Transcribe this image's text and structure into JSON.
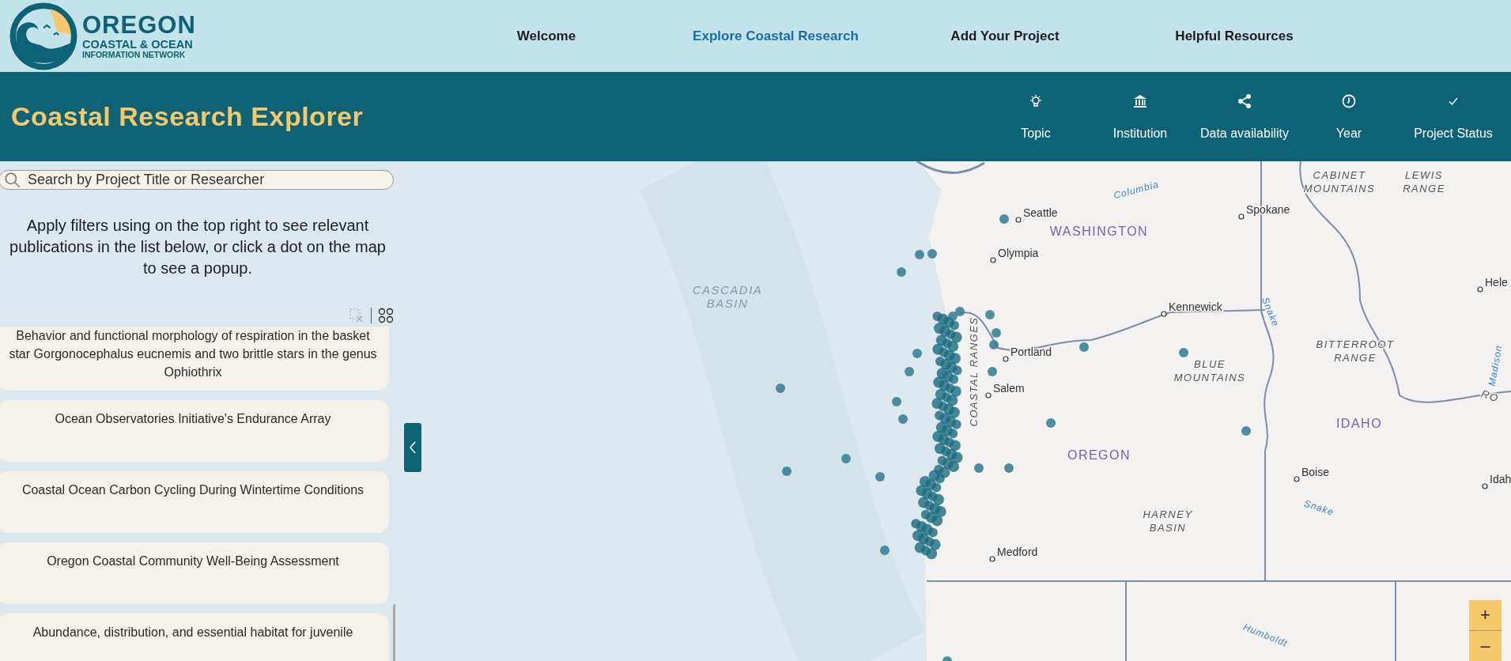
{
  "logo": {
    "title": "OREGON",
    "line_1": "COASTAL & OCEAN",
    "line_2": "INFORMATION NETWORK"
  },
  "nav": [
    {
      "label": "Welcome",
      "selected": false
    },
    {
      "label": "Explore Coastal Research",
      "selected": true
    },
    {
      "label": "Add Your Project",
      "selected": false
    },
    {
      "label": "Helpful Resources",
      "selected": false
    }
  ],
  "app_title": "Coastal Research Explorer",
  "filters": [
    {
      "label": "Topic",
      "kind": "bulb"
    },
    {
      "label": "Institution",
      "kind": "institution"
    },
    {
      "label": "Data availability",
      "kind": "share"
    },
    {
      "label": "Year",
      "kind": "clock"
    },
    {
      "label": "Project Status",
      "kind": "check"
    }
  ],
  "search": {
    "placeholder": "Search by Project Title or Researcher"
  },
  "instructions": "Apply filters using on the top right to see relevant publications in the list below, or click a dot on the map to see a popup.",
  "projects": [
    {
      "title": "Behavior and functional morphology of respiration in the basket star Gorgonocephalus eucnemis and two brittle stars in the genus Ophiothrix"
    },
    {
      "title": "Ocean Observatories Initiative's Endurance Array"
    },
    {
      "title": "Coastal Ocean Carbon Cycling During Wintertime Conditions"
    },
    {
      "title": "Oregon Coastal Community Well-Being Assessment"
    },
    {
      "title": "Abundance, distribution, and essential habitat for juvenile"
    }
  ],
  "map": {
    "labels": [
      {
        "kind": "river",
        "lines": [
          "Columbia"
        ]
      },
      {
        "kind": "region",
        "lines": [
          "CABINET",
          "MOUNTAINS"
        ]
      },
      {
        "kind": "region",
        "lines": [
          "LEWIS",
          "RANGE"
        ]
      },
      {
        "kind": "city",
        "lines": [
          "Seattle"
        ]
      },
      {
        "kind": "city",
        "lines": [
          "Spokane"
        ]
      },
      {
        "kind": "state",
        "lines": [
          "WASHINGTON"
        ]
      },
      {
        "kind": "city",
        "lines": [
          "Olympia"
        ]
      },
      {
        "kind": "water",
        "lines": [
          "CASCADIA",
          "BASIN"
        ]
      },
      {
        "kind": "city",
        "lines": [
          "Hele"
        ]
      },
      {
        "kind": "city",
        "lines": [
          "Kennewick"
        ]
      },
      {
        "kind": "river",
        "lines": [
          "Snake"
        ]
      },
      {
        "kind": "region",
        "lines": [
          "COASTAL RANGES"
        ]
      },
      {
        "kind": "city",
        "lines": [
          "Portland"
        ]
      },
      {
        "kind": "region",
        "lines": [
          "BITTERROOT",
          "RANGE"
        ]
      },
      {
        "kind": "river",
        "lines": [
          "Madison"
        ]
      },
      {
        "kind": "region",
        "lines": [
          "BLUE",
          "MOUNTAINS"
        ]
      },
      {
        "kind": "region",
        "lines": [
          "RO"
        ]
      },
      {
        "kind": "city",
        "lines": [
          "Salem"
        ]
      },
      {
        "kind": "state",
        "lines": [
          "IDAHO"
        ]
      },
      {
        "kind": "state",
        "lines": [
          "OREGON"
        ]
      },
      {
        "kind": "city",
        "lines": [
          "Boise"
        ]
      },
      {
        "kind": "city",
        "lines": [
          "Idah"
        ]
      },
      {
        "kind": "region",
        "lines": [
          "HARNEY",
          "BASIN"
        ]
      },
      {
        "kind": "river",
        "lines": [
          "Snake"
        ]
      },
      {
        "kind": "city",
        "lines": [
          "Medford"
        ]
      },
      {
        "kind": "river",
        "lines": [
          "Humboldt"
        ]
      }
    ],
    "zoom_in": "+",
    "zoom_out": "–"
  }
}
